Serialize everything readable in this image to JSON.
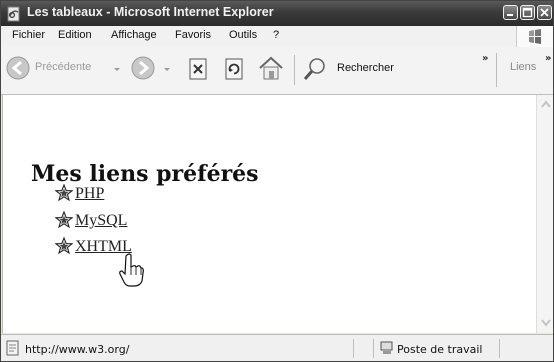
{
  "window": {
    "title": "Les tableaux - Microsoft Internet Explorer"
  },
  "menu": {
    "items": [
      "Fichier",
      "Edition",
      "Affichage",
      "Favoris",
      "Outils",
      "?"
    ]
  },
  "toolbar": {
    "back_label": "Précédente",
    "search_label": "Rechercher",
    "links_label": "Liens",
    "chevron": "»"
  },
  "page": {
    "heading": "Mes liens préférés",
    "links": [
      {
        "label": " PHP"
      },
      {
        "label": " MySQL"
      },
      {
        "label": " XHTML"
      }
    ]
  },
  "status": {
    "url": "http://www.w3.org/",
    "zone": "Poste de travail"
  },
  "icons": {
    "link_bullet": "star-icon",
    "cursor": "hand-pointer-icon"
  },
  "colors": {
    "titlebar": "#3a3a3a",
    "page_background": "#ffffff"
  }
}
